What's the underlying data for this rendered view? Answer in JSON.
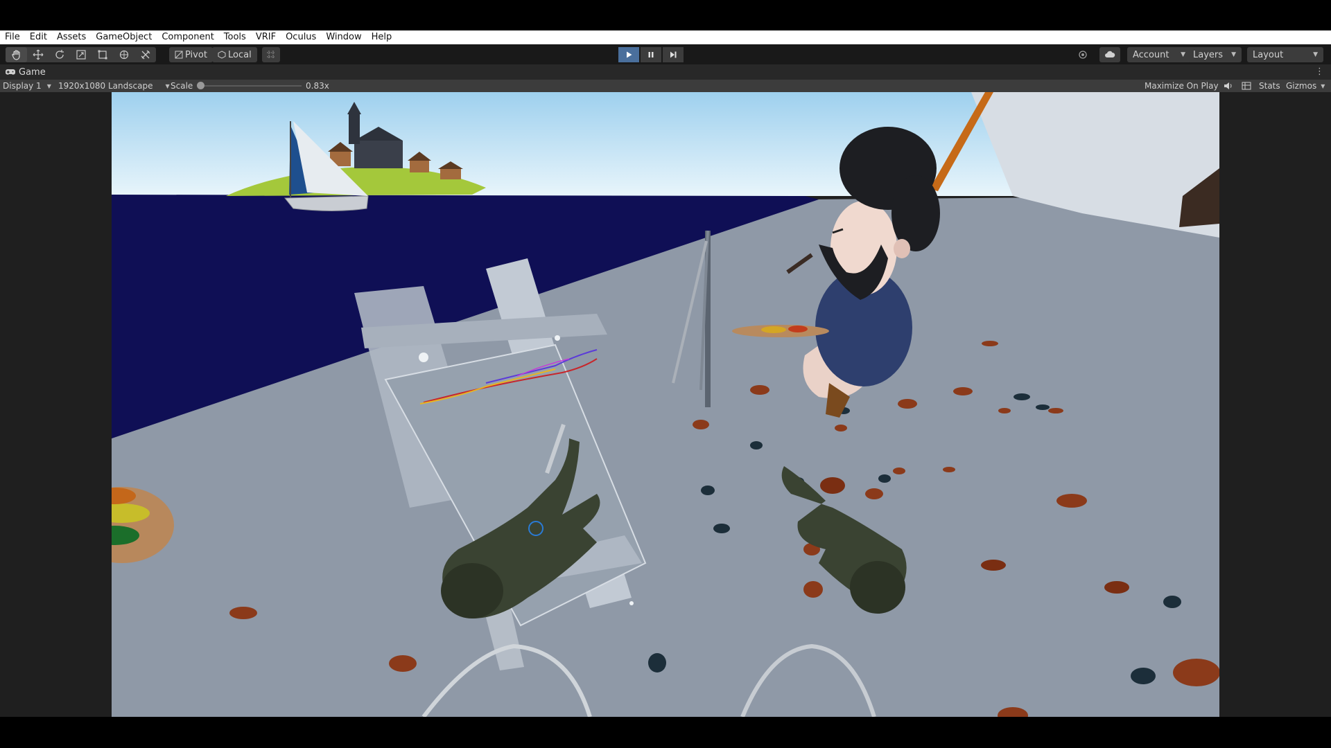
{
  "menu": [
    "File",
    "Edit",
    "Assets",
    "GameObject",
    "Component",
    "Tools",
    "VRIF",
    "Oculus",
    "Window",
    "Help"
  ],
  "toolbar": {
    "tools": [
      "hand-tool-icon",
      "move-tool-icon",
      "rotate-tool-icon",
      "scale-tool-icon",
      "rect-tool-icon",
      "transform-tool-icon",
      "custom-tool-icon"
    ],
    "pivot_label": "Pivot",
    "local_label": "Local",
    "account_label": "Account",
    "layers_label": "Layers",
    "layout_label": "Layout",
    "play_state": "playing"
  },
  "tab": {
    "label": "Game"
  },
  "game_bar": {
    "display": "Display 1",
    "resolution": "1920x1080 Landscape",
    "scale_label": "Scale",
    "scale_value": "0.83x",
    "scale_fraction": 0.05,
    "maximize_label": "Maximize On Play",
    "stats_label": "Stats",
    "gizmos_label": "Gizmos"
  },
  "colors": {
    "sky": "#bfe4f7",
    "water": "#0d0d52",
    "ground": "#8e98a6",
    "island": "#a3c93a",
    "play_active": "#4a6f9c"
  }
}
